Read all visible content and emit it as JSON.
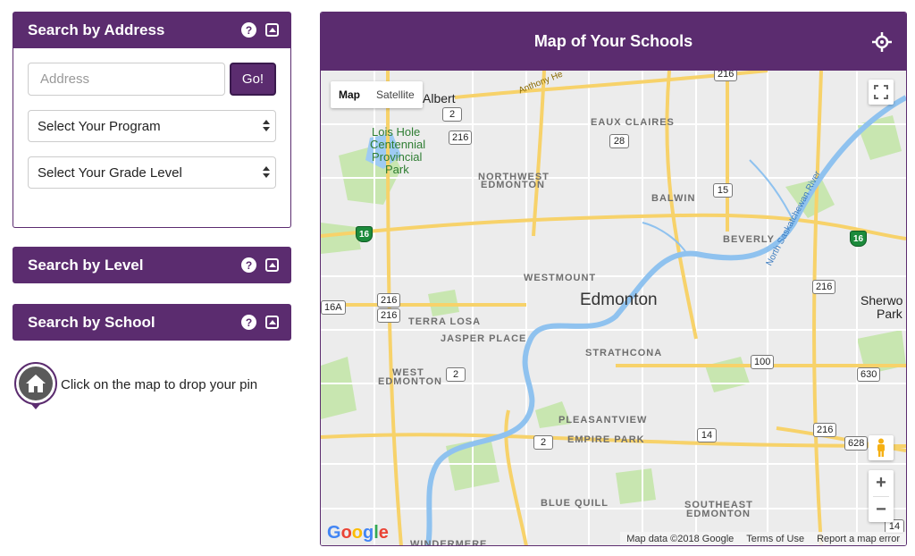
{
  "search_address": {
    "title": "Search by Address",
    "address_placeholder": "Address",
    "go_label": "Go!",
    "program_select": "Select Your Program",
    "grade_select": "Select Your Grade Level"
  },
  "search_level": {
    "title": "Search by Level"
  },
  "search_school": {
    "title": "Search by School"
  },
  "help_glyph": "?",
  "pin_hint": "Click on the map to drop your pin",
  "map": {
    "title": "Map of Your Schools",
    "map_type_map": "Map",
    "map_type_satellite": "Satellite",
    "zoom_in": "+",
    "zoom_out": "−",
    "google": [
      "G",
      "o",
      "o",
      "g",
      "l",
      "e"
    ],
    "google_colors": [
      "#4285f4",
      "#ea4335",
      "#fbbc05",
      "#4285f4",
      "#34a853",
      "#ea4335"
    ],
    "attribution": {
      "data": "Map data ©2018 Google",
      "terms": "Terms of Use",
      "report": "Report a map error"
    },
    "labels": {
      "city": "Edmonton",
      "albert": "Albert",
      "lois_hole": "Lois Hole",
      "centennial": "Centennial",
      "provincial": "Provincial",
      "park": "Park",
      "sherwo": "Sherwo",
      "sherwo_park": "Park",
      "eaux_claires": "EAUX CLAIRES",
      "northwest": "NORTHWEST",
      "nw_edmonton": "EDMONTON",
      "balwin": "BALWIN",
      "beverly": "BEVERLY",
      "westmount": "WESTMOUNT",
      "terra_losa": "TERRA LOSA",
      "jasper_place": "JASPER PLACE",
      "strathcona": "STRATHCONA",
      "west": "WEST",
      "west_edmonton": "EDMONTON",
      "pleasantview": "PLEASANTVIEW",
      "empire_park": "EMPIRE PARK",
      "blue_quill": "BLUE QUILL",
      "southeast": "SOUTHEAST",
      "se_edmonton": "EDMONTON",
      "windermere": "WINDERMERE",
      "river": "North Saskatchewan River",
      "anthony": "Anthony He"
    },
    "shields": {
      "s216_top": "216",
      "s2_top": "2",
      "s216_a": "216",
      "s28": "28",
      "s15": "15",
      "s16_left": "16",
      "s16_right": "16",
      "s16a": "16A",
      "s216_left1": "216",
      "s216_left2": "216",
      "s216_right": "216",
      "s2_mid": "2",
      "s100": "100",
      "s630": "630",
      "s2_low": "2",
      "s14": "14",
      "s216_low": "216",
      "s628": "628",
      "s14_bottom": "14"
    }
  }
}
